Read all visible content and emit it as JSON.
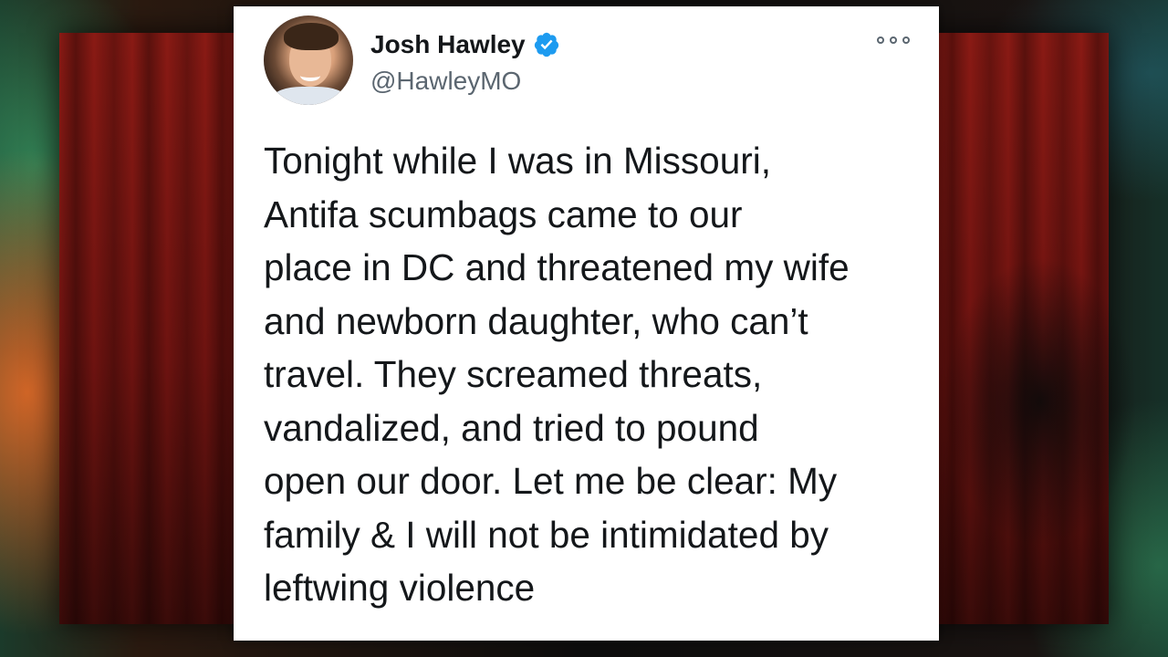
{
  "tweet": {
    "author_name": "Josh Hawley",
    "author_handle": "@HawleyMO",
    "verified": true,
    "text_lines": [
      "Tonight while I was in Missouri,",
      "Antifa scumbags came to our",
      "place in DC and threatened my wife",
      "and newborn daughter, who can’t",
      "travel. They screamed threats,",
      "vandalized, and tried to pound",
      "open our door. Let me be clear: My",
      "family & I will not be intimidated by",
      "leftwing violence"
    ]
  },
  "icons": {
    "verified": "verified-badge-icon",
    "more": "more-options-icon"
  },
  "colors": {
    "card_background": "#ffffff",
    "text": "#14171a",
    "handle_text": "#5b6670",
    "verified_blue": "#1d9bf0",
    "curtain_red": "#7a1712"
  }
}
